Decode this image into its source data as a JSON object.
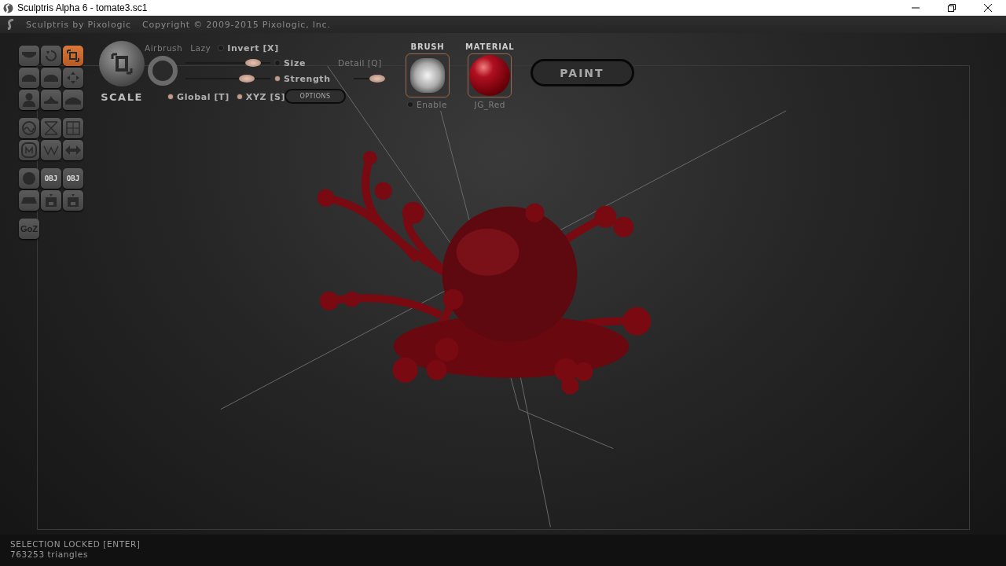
{
  "window": {
    "title": "Sculptris Alpha 6 - tomate3.sc1"
  },
  "header": {
    "brand": "Sculptris by Pixologic",
    "copyright": "Copyright © 2009-2015 Pixologic, Inc."
  },
  "tool_groups": [
    {
      "tools": [
        {
          "kind": "crease",
          "selected": false
        },
        {
          "kind": "rotate",
          "selected": false
        },
        {
          "kind": "scale",
          "selected": true
        },
        {
          "kind": "draw",
          "selected": false
        },
        {
          "kind": "flatten",
          "selected": false
        },
        {
          "kind": "grab",
          "selected": false
        },
        {
          "kind": "inflate",
          "selected": false
        },
        {
          "kind": "pinch",
          "selected": false
        },
        {
          "kind": "smooth",
          "selected": false
        }
      ]
    },
    {
      "tools": [
        {
          "kind": "reduce",
          "selected": false
        },
        {
          "kind": "mask",
          "selected": false
        },
        {
          "kind": "grid",
          "selected": false
        },
        {
          "kind": "symmetry",
          "selected": false
        },
        {
          "kind": "wire",
          "selected": false
        },
        {
          "kind": "mirror",
          "selected": false
        }
      ]
    },
    {
      "tools": [
        {
          "kind": "sphere",
          "selected": false
        },
        {
          "kind": "obj",
          "label": "OBJ",
          "selected": false
        },
        {
          "kind": "obj",
          "label": "OBJ",
          "selected": false
        },
        {
          "kind": "plane",
          "selected": false
        },
        {
          "kind": "save",
          "selected": false
        },
        {
          "kind": "save",
          "selected": false
        }
      ]
    },
    {
      "tools": [
        {
          "kind": "text",
          "label": "GoZ",
          "selected": false
        }
      ]
    }
  ],
  "brush_panel": {
    "tool_name": "SCALE",
    "airbrush": "Airbrush",
    "lazy": "Lazy",
    "invert": {
      "label": "Invert [X]",
      "on": false
    },
    "size": {
      "label": "Size",
      "on": false,
      "level": 0.8
    },
    "strength": {
      "label": "Strength",
      "on": true,
      "level": 0.72
    },
    "detail": {
      "label": "Detail [Q]",
      "level": 0.75
    },
    "global": {
      "label": "Global [T]",
      "on": true
    },
    "xyz": {
      "label": "XYZ [S]",
      "on": true
    },
    "options_button": "OPTIONS"
  },
  "brush": {
    "title": "BRUSH",
    "enable": {
      "label": "Enable",
      "on": false
    }
  },
  "material": {
    "title": "MATERIAL",
    "name": "JG_Red"
  },
  "paint_button": "PAINT",
  "status": {
    "lines": [
      "SELECTION LOCKED [ENTER]",
      "763253 triangles"
    ]
  }
}
